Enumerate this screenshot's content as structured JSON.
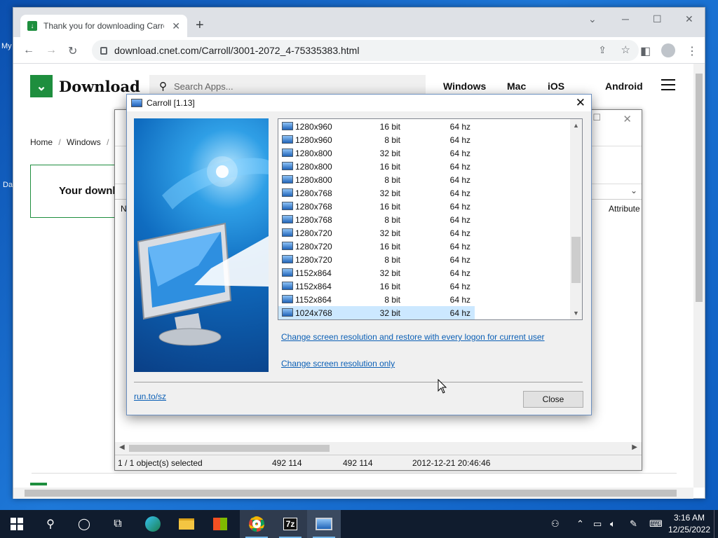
{
  "desktop": {
    "label_1": "My",
    "label_2": "Da"
  },
  "browser": {
    "tab_title": "Thank you for downloading Carroll",
    "new_tab": "+",
    "url": "download.cnet.com/Carroll/3001-2072_4-75335383.html"
  },
  "site": {
    "brand": "Download",
    "search_placeholder": "Search Apps...",
    "nav": [
      "Windows",
      "Mac",
      "iOS",
      "Android"
    ],
    "breadcrumb": [
      "Home",
      "Windows"
    ],
    "download_msg": "Your downl"
  },
  "sevenzip": {
    "column_name": "N",
    "column_attributes": "Attribute",
    "status": {
      "selected": "1 / 1 object(s) selected",
      "size": "492 114",
      "packed": "492 114",
      "modified": "2012-12-21 20:46:46"
    }
  },
  "dialog": {
    "title": "Carroll [1.13]",
    "resolutions": [
      {
        "res": "1280x960",
        "bit": "16 bit",
        "hz": "64 hz"
      },
      {
        "res": "1280x960",
        "bit": "8 bit",
        "hz": "64 hz"
      },
      {
        "res": "1280x800",
        "bit": "32 bit",
        "hz": "64 hz"
      },
      {
        "res": "1280x800",
        "bit": "16 bit",
        "hz": "64 hz"
      },
      {
        "res": "1280x800",
        "bit": "8 bit",
        "hz": "64 hz"
      },
      {
        "res": "1280x768",
        "bit": "32 bit",
        "hz": "64 hz"
      },
      {
        "res": "1280x768",
        "bit": "16 bit",
        "hz": "64 hz"
      },
      {
        "res": "1280x768",
        "bit": "8 bit",
        "hz": "64 hz"
      },
      {
        "res": "1280x720",
        "bit": "32 bit",
        "hz": "64 hz"
      },
      {
        "res": "1280x720",
        "bit": "16 bit",
        "hz": "64 hz"
      },
      {
        "res": "1280x720",
        "bit": "8 bit",
        "hz": "64 hz"
      },
      {
        "res": "1152x864",
        "bit": "32 bit",
        "hz": "64 hz"
      },
      {
        "res": "1152x864",
        "bit": "16 bit",
        "hz": "64 hz"
      },
      {
        "res": "1152x864",
        "bit": "8 bit",
        "hz": "64 hz"
      },
      {
        "res": "1024x768",
        "bit": "32 bit",
        "hz": "64 hz",
        "selected": true
      }
    ],
    "link_restore": "Change screen resolution and restore with every logon for current user",
    "link_only": "Change screen resolution only",
    "link_site": "run.to/sz",
    "close_label": "Close"
  },
  "taskbar": {
    "time": "3:16 AM",
    "date": "12/25/2022",
    "seven_zip_label": "7z"
  }
}
